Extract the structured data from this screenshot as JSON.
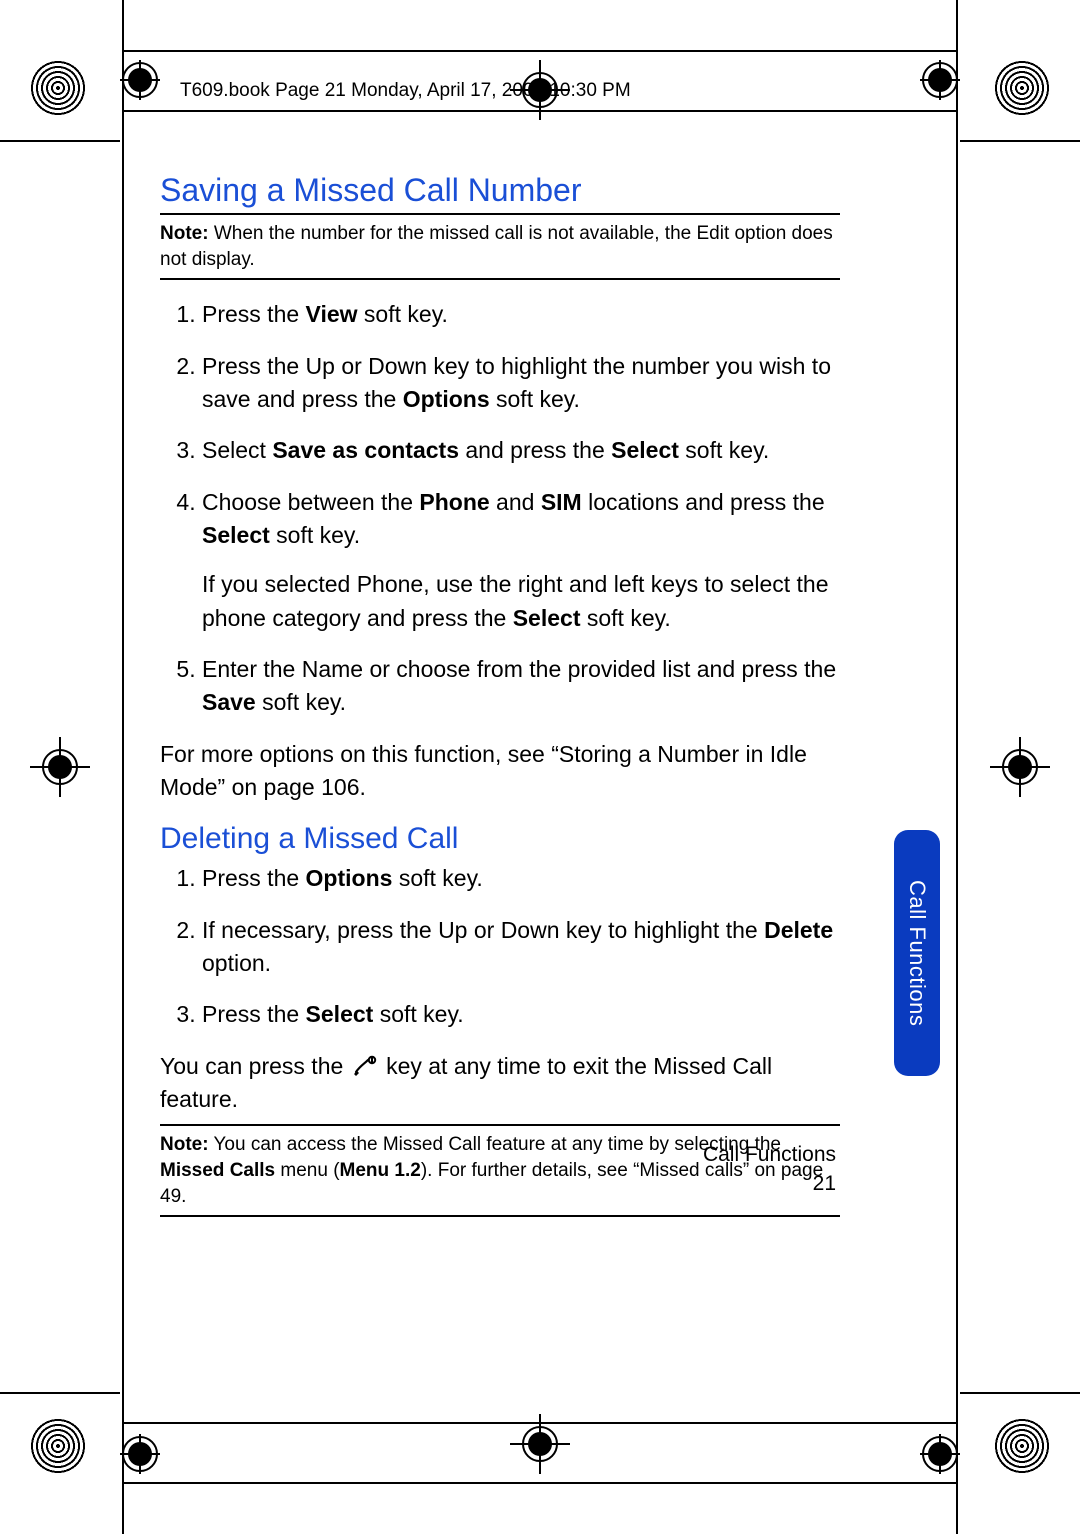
{
  "running_head": "T609.book  Page 21  Monday, April 17, 2006  10:30 PM",
  "section1": {
    "title": "Saving a Missed Call Number",
    "note_label": "Note:",
    "note_text": " When the number for the missed call is not available, the Edit option does not display.",
    "step1_a": "Press the ",
    "step1_b": "View",
    "step1_c": " soft key.",
    "step2_a": "Press the Up or Down key to highlight the number you wish to save and press the ",
    "step2_b": "Options",
    "step2_c": " soft key.",
    "step3_a": "Select ",
    "step3_b": "Save as contacts",
    "step3_c": " and press the ",
    "step3_d": "Select",
    "step3_e": " soft key.",
    "step4_a": "Choose between the ",
    "step4_b": "Phone",
    "step4_c": " and ",
    "step4_d": "SIM",
    "step4_e": " locations and press the ",
    "step4_f": "Select",
    "step4_g": " soft key.",
    "step4_p2_a": "If you selected Phone, use the right and left keys to select the phone category and press the ",
    "step4_p2_b": "Select",
    "step4_p2_c": " soft key.",
    "step5_a": "Enter the Name or choose from the provided list and press the ",
    "step5_b": "Save",
    "step5_c": " soft key.",
    "closing": "For more options on this function, see “Storing a Number in Idle Mode” on page 106."
  },
  "section2": {
    "title": "Deleting a Missed Call",
    "step1_a": "Press the ",
    "step1_b": "Options",
    "step1_c": " soft key.",
    "step2_a": "If necessary, press the Up or Down key to highlight the ",
    "step2_b": "Delete",
    "step2_c": " option.",
    "step3_a": "Press the ",
    "step3_b": "Select",
    "step3_c": " soft key.",
    "closing_a": "You can press the ",
    "closing_b": " key at any time to exit the Missed Call feature.",
    "note_label": "Note:",
    "note_text_a": " You can access the Missed Call feature at any time by selecting the ",
    "note_text_b": "Missed Calls",
    "note_text_c": " menu (",
    "note_text_d": "Menu 1.2",
    "note_text_e": "). For further details, see “Missed calls” on page 49."
  },
  "thumb_tab": "Call Functions",
  "footer": {
    "section": "Call Functions",
    "page": "21"
  }
}
